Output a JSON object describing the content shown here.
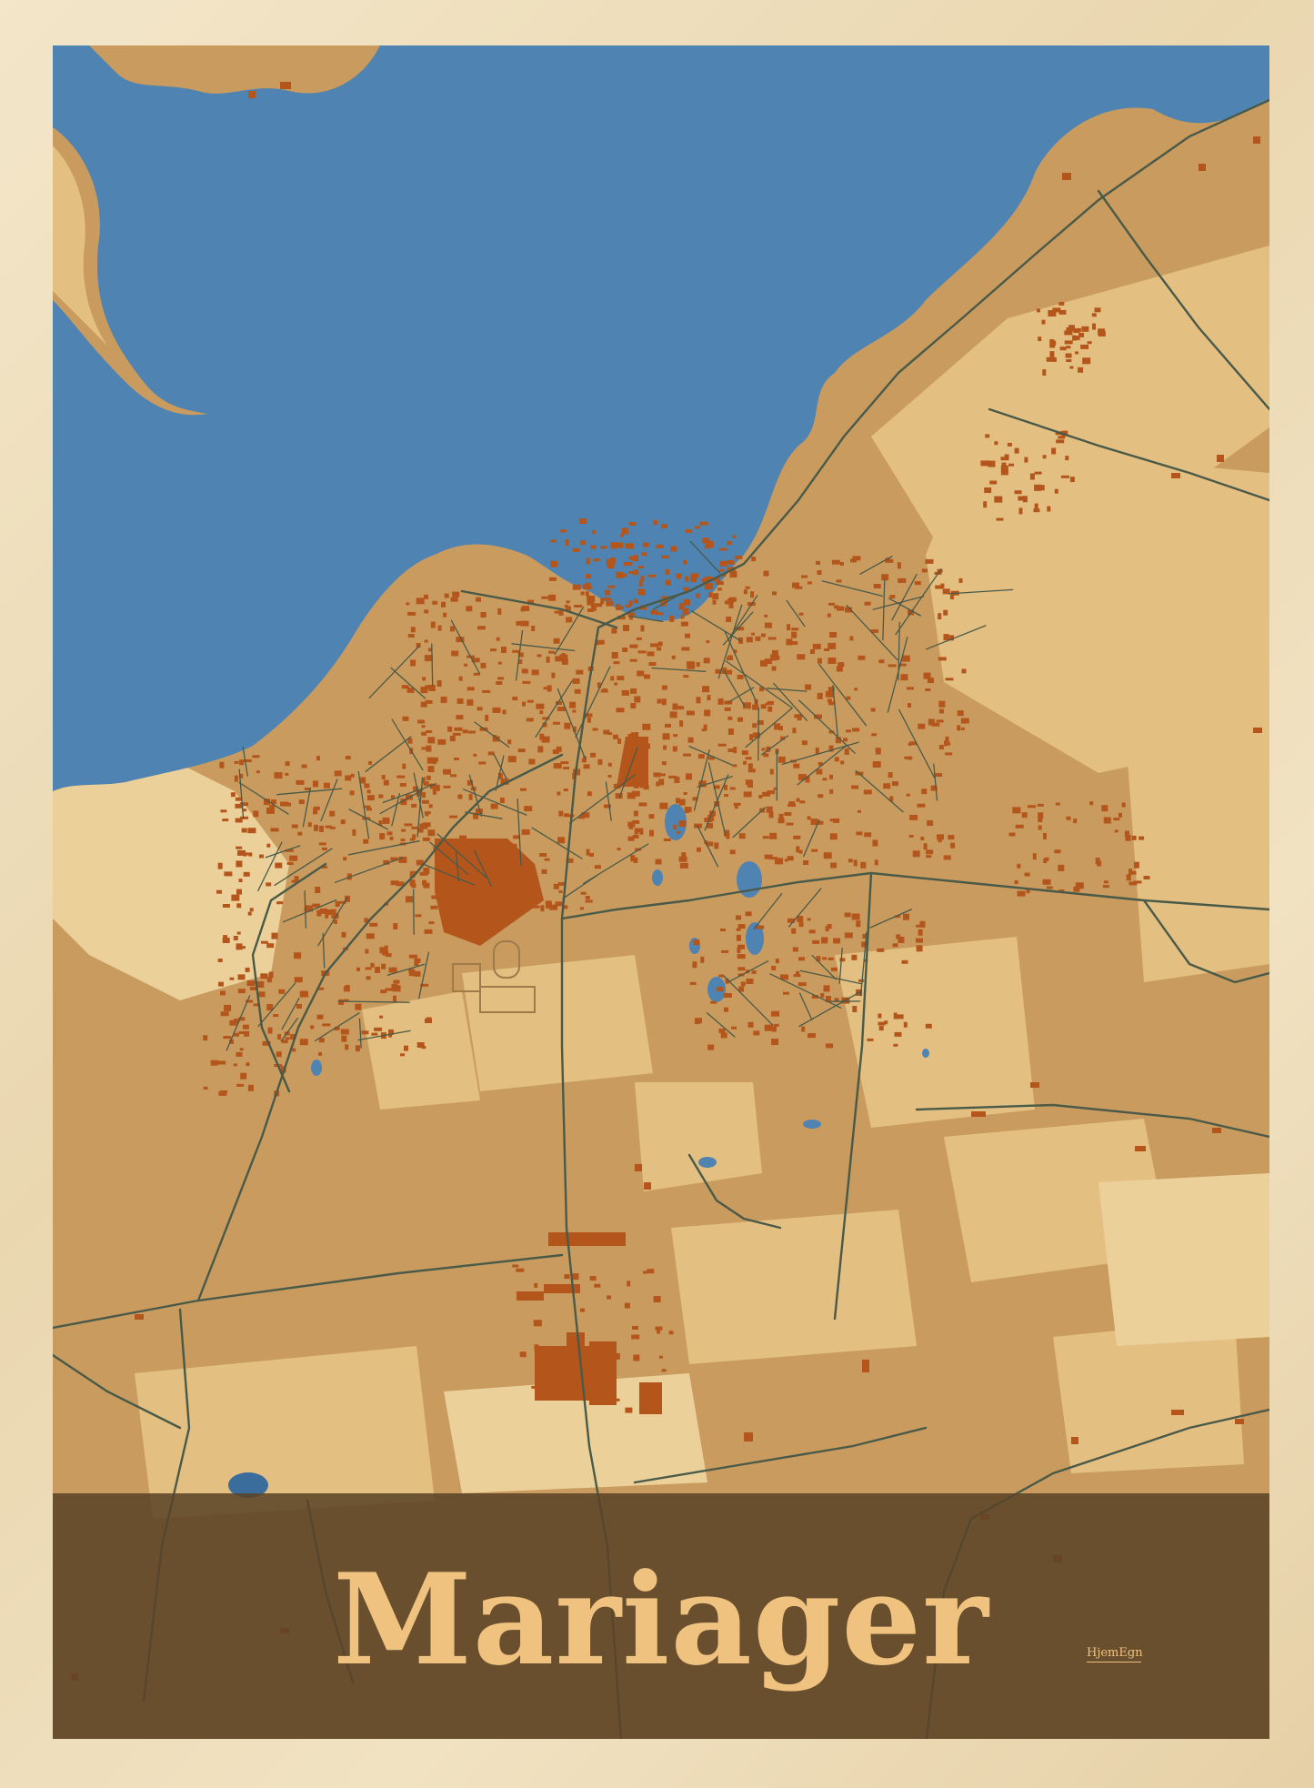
{
  "poster": {
    "city_name": "Mariager",
    "brand": "HjemEgn"
  },
  "colors": {
    "water": "#4f83b1",
    "land": "#c99b5f",
    "land_light": "#e3bf82",
    "land_pale": "#ecd09a",
    "buildings": "#b4561c",
    "roads": "#4a5a48",
    "title_band": "#5a4226",
    "title_text": "#efc27f",
    "frame": "#f0e1c2"
  }
}
